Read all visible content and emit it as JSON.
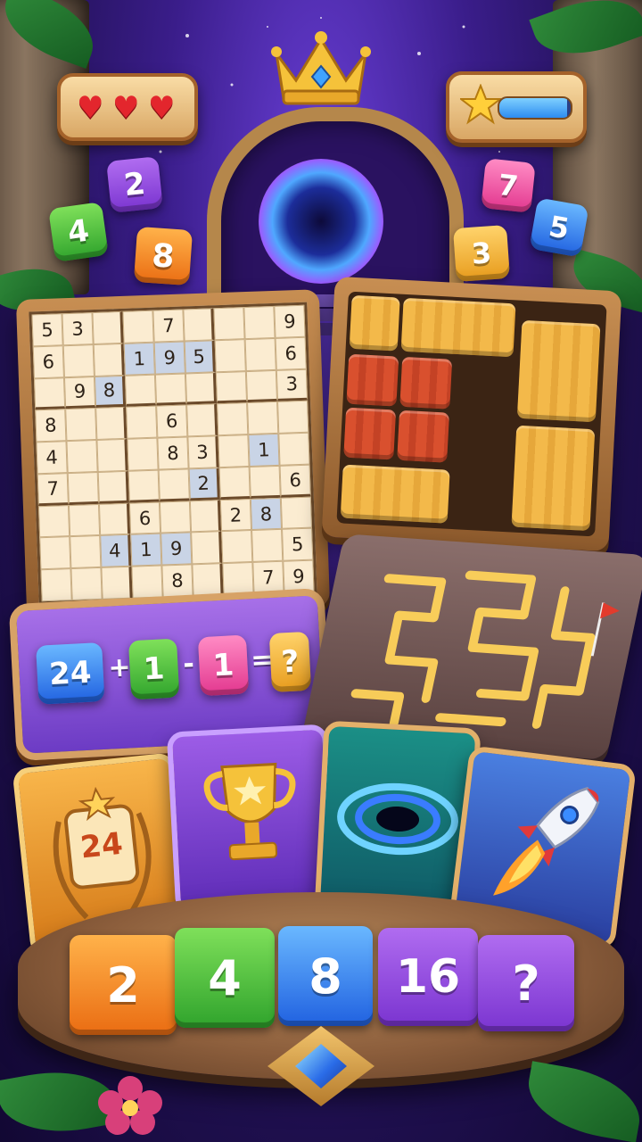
{
  "hud": {
    "lives": {
      "icon": "heart-icon",
      "count": 3
    },
    "progress": {
      "icon": "star-icon",
      "fill_fraction": 0.95
    }
  },
  "crown": {
    "icon": "crown-icon"
  },
  "portal": {
    "icon": "portal-icon"
  },
  "floating_tiles": [
    {
      "value": "2",
      "color": "#9b59e6"
    },
    {
      "value": "4",
      "color": "#3fbf3a"
    },
    {
      "value": "8",
      "color": "#f08a1c"
    },
    {
      "value": "7",
      "color": "#f05aa8"
    },
    {
      "value": "5",
      "color": "#3a86f0"
    },
    {
      "value": "3",
      "color": "#f0a92a"
    }
  ],
  "sudoku": {
    "rows": [
      [
        "5",
        "3",
        "",
        "",
        "7",
        "",
        "",
        "",
        "9"
      ],
      [
        "6",
        "",
        "",
        "1",
        "9",
        "5",
        "",
        "",
        "6"
      ],
      [
        "",
        "9",
        "8",
        "",
        "",
        "",
        "",
        "",
        "3"
      ],
      [
        "8",
        "",
        "",
        "",
        "6",
        "",
        "",
        "",
        ""
      ],
      [
        "4",
        "",
        "",
        "",
        "8",
        "3",
        "",
        "1",
        ""
      ],
      [
        "7",
        "",
        "",
        "",
        "",
        "2",
        "",
        "",
        "6"
      ],
      [
        "",
        "",
        "",
        "6",
        "",
        "",
        "2",
        "8",
        ""
      ],
      [
        "",
        "",
        "4",
        "1",
        "9",
        "",
        "",
        "",
        "5"
      ],
      [
        "",
        "",
        "",
        "",
        "8",
        "",
        "",
        "7",
        "9"
      ]
    ],
    "highlighted": [
      [
        1,
        3
      ],
      [
        1,
        4
      ],
      [
        1,
        5
      ],
      [
        2,
        2
      ],
      [
        4,
        7
      ],
      [
        5,
        5
      ],
      [
        6,
        7
      ],
      [
        7,
        2
      ],
      [
        7,
        3
      ],
      [
        7,
        4
      ]
    ]
  },
  "block_puzzle": {
    "icon": "wooden-block-puzzle-icon"
  },
  "equation": {
    "terms": [
      "24",
      "1",
      "1",
      "?"
    ],
    "operators": [
      "+",
      "-",
      "="
    ]
  },
  "maze": {
    "icon": "maze-icon",
    "goal_icon": "red-flag-icon"
  },
  "cards": [
    {
      "name": "badge-card",
      "icon": "laurel-badge-icon",
      "label": "24"
    },
    {
      "name": "trophy-card",
      "icon": "trophy-icon"
    },
    {
      "name": "black-hole-card",
      "icon": "black-hole-icon"
    },
    {
      "name": "rocket-card",
      "icon": "rocket-icon"
    }
  ],
  "sequence": [
    "2",
    "4",
    "8",
    "16",
    "?"
  ],
  "gem": {
    "icon": "blue-gem-icon"
  },
  "colors": {
    "wood": "#b5874b",
    "sky_top": "#6a3fd8",
    "sky_bottom": "#120833"
  }
}
